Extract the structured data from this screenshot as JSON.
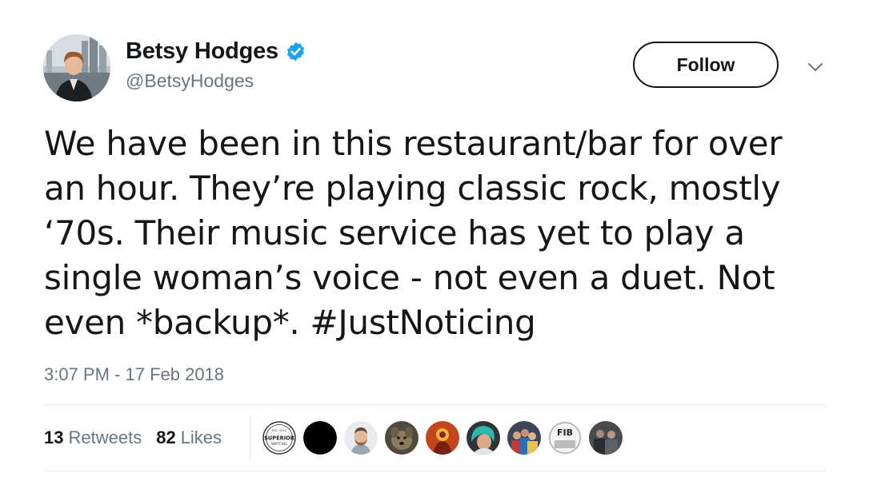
{
  "tweet": {
    "author": {
      "display_name": "Betsy Hodges",
      "handle": "@BetsyHodges",
      "verified": true
    },
    "follow_label": "Follow",
    "text_lines": [
      "We have been in this restaurant/bar for over",
      "an hour. They’re playing classic rock, mostly",
      "‘70s. Their music service has yet to play a",
      "single woman’s voice - not even a duet. Not",
      "even *backup*. "
    ],
    "hashtag": "#JustNoticing",
    "timestamp": "3:07 PM - 17 Feb 2018",
    "stats": {
      "retweets_count": "13",
      "retweets_label": "Retweets",
      "likes_count": "82",
      "likes_label": "Likes"
    },
    "liker_avatars": [
      {
        "icon": "superior-switchel-logo",
        "badge_top": "EST. 2016",
        "badge_main": "SUPERIOR",
        "badge_sub": "SWITCHEL"
      },
      {
        "icon": "black-circle-avatar"
      },
      {
        "icon": "man-photo-avatar"
      },
      {
        "icon": "dog-photo-avatar"
      },
      {
        "icon": "orange-art-avatar"
      },
      {
        "icon": "teal-hair-avatar"
      },
      {
        "icon": "group-photo-avatar"
      },
      {
        "icon": "fib-logo-avatar",
        "badge_main": "FIB"
      },
      {
        "icon": "dark-photo-avatar"
      }
    ],
    "colors": {
      "text": "#14171a",
      "secondary": "#657786",
      "verified": "#1da1f2",
      "divider": "#e6ecf0"
    }
  }
}
